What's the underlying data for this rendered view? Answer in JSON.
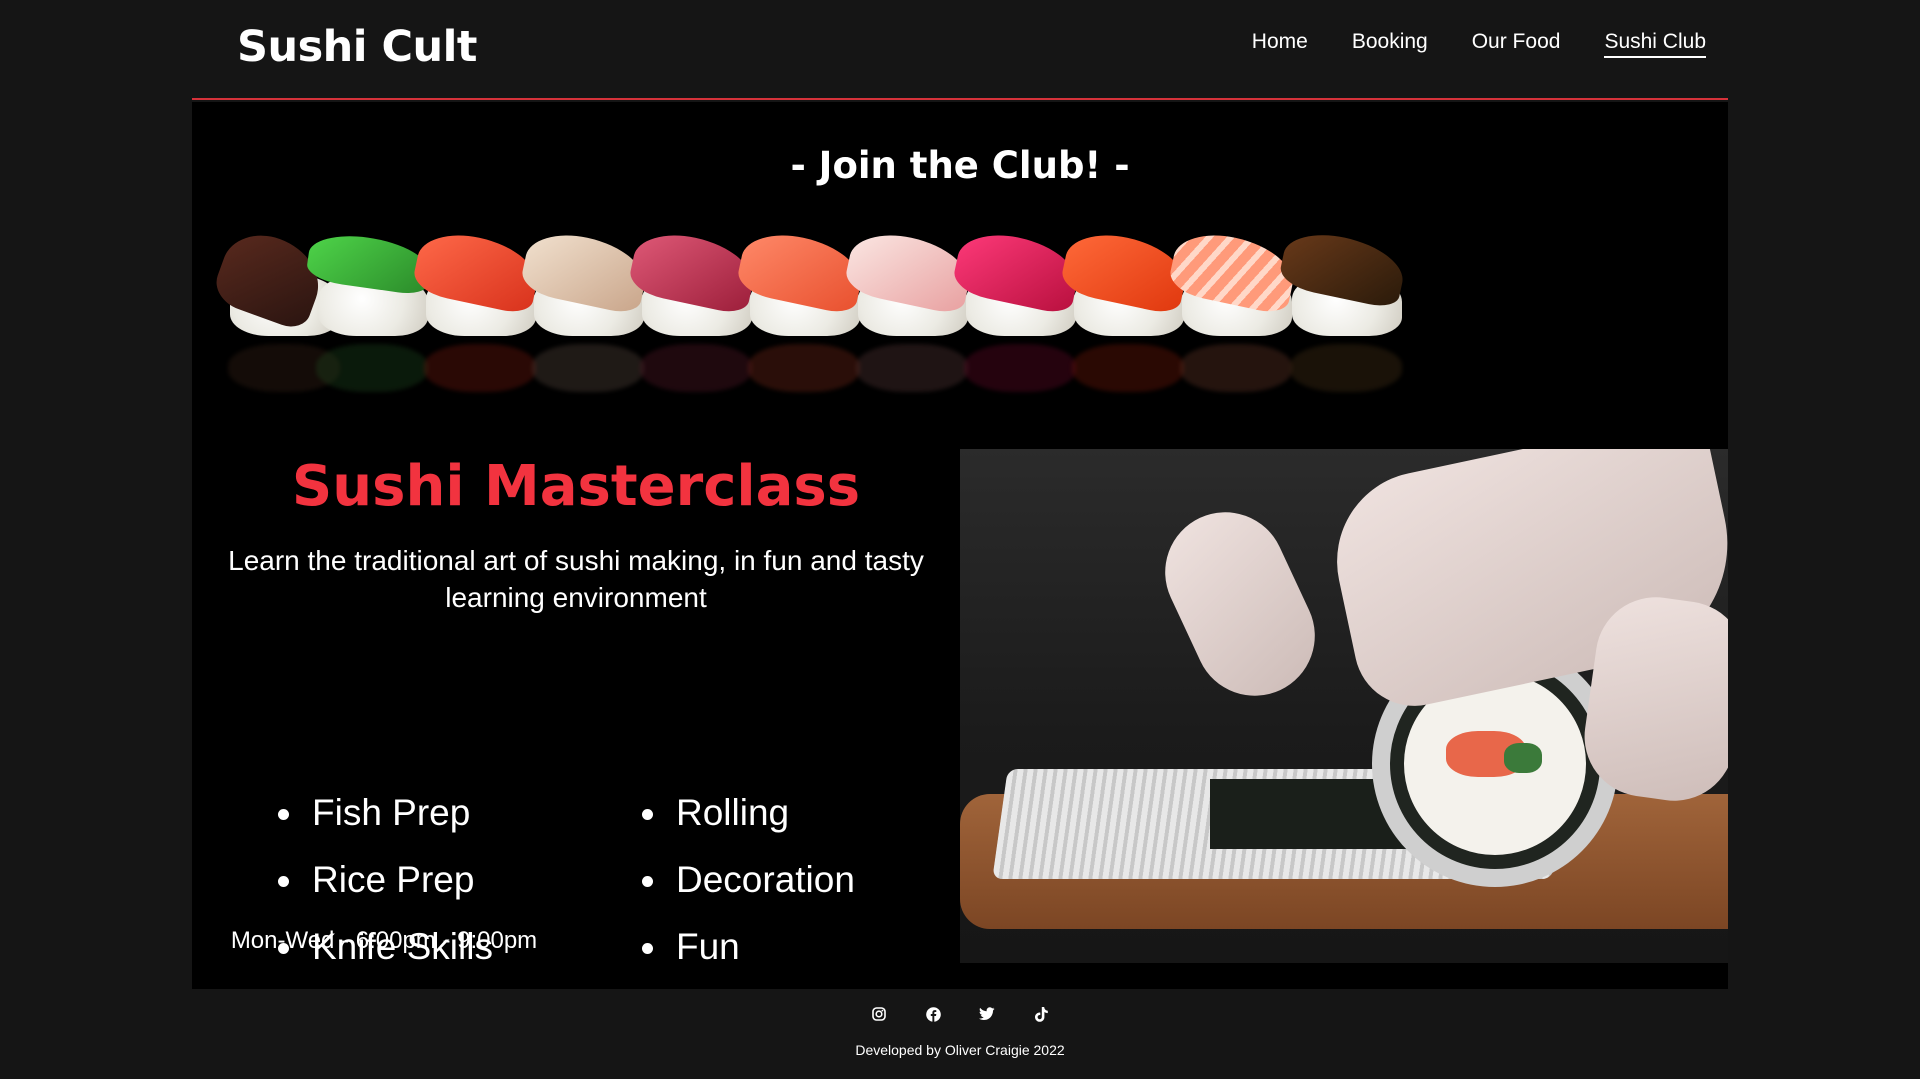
{
  "header": {
    "brand": "Sushi Cult",
    "nav": {
      "home": "Home",
      "booking": "Booking",
      "our_food": "Our Food",
      "sushi_club": "Sushi Club"
    },
    "active_nav": "Sushi Club"
  },
  "club": {
    "title": "- Join the Club! -"
  },
  "masterclass": {
    "title": "Sushi Masterclass",
    "description": "Learn the traditional art of sushi making, in fun and tasty learning environment",
    "topics": [
      "Fish Prep",
      "Rolling",
      "Rice Prep",
      "Decoration",
      "Knife Skills",
      "Fun"
    ],
    "schedule": "Mon-Wed - 6:00pm - 9:00pm"
  },
  "footer": {
    "icons": [
      "instagram-icon",
      "facebook-icon",
      "twitter-icon",
      "tiktok-icon"
    ],
    "credit": "Developed by Oliver Craigie 2022"
  },
  "colors": {
    "accent": "#f2333f",
    "header_rule": "#d6323a",
    "background": "#151515",
    "panel": "#000000"
  }
}
